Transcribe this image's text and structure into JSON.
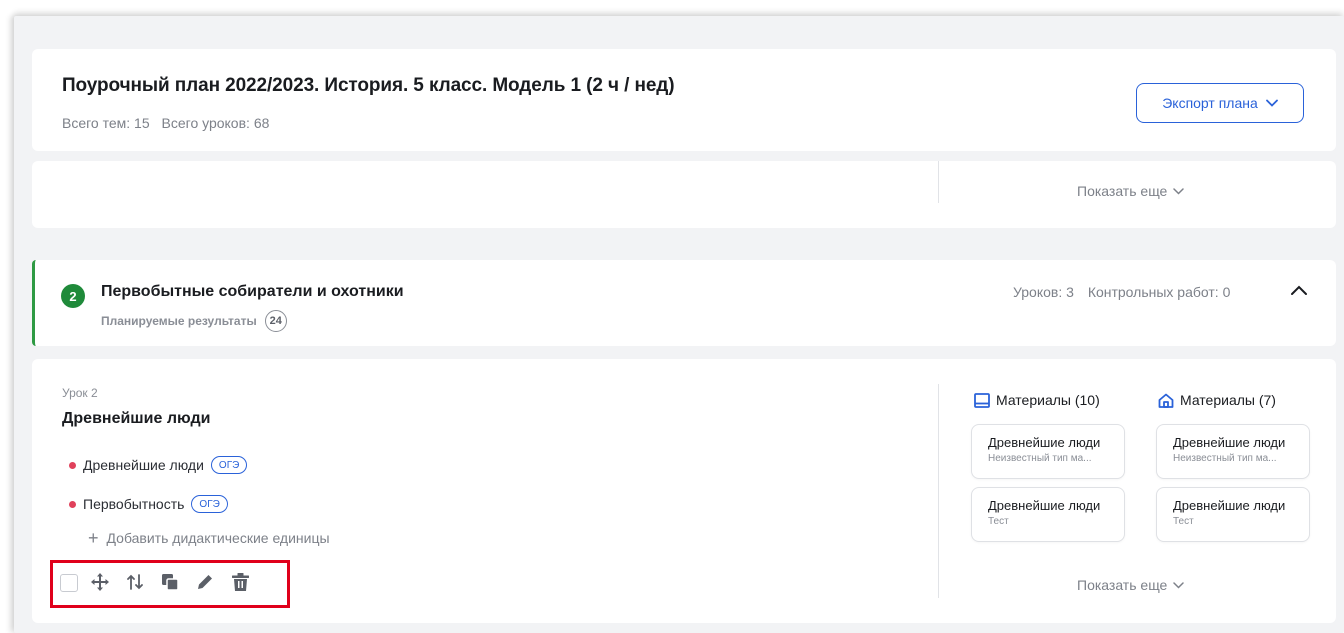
{
  "header": {
    "title": "Поурочный план 2022/2023. История. 5 класс. Модель 1 (2 ч / нед)",
    "total_topics": "Всего тем: 15",
    "total_lessons": "Всего уроков: 68",
    "export_button": "Экспорт плана"
  },
  "show_more_label": "Показать еще",
  "topic": {
    "number": "2",
    "title": "Первобытные собиратели и охотники",
    "planned_results_label": "Планируемые результаты",
    "planned_results_count": "24",
    "lessons_count": "Уроков: 3",
    "tests_count": "Контрольных работ: 0"
  },
  "lesson": {
    "number_label": "Урок 2",
    "title": "Древнейшие люди",
    "didactic_units": [
      {
        "label": "Древнейшие люди",
        "badge": "ОГЭ"
      },
      {
        "label": "Первобытность",
        "badge": "ОГЭ"
      }
    ],
    "add_units_label": "Добавить дидактические единицы",
    "materials_left": {
      "header": "Материалы (10)",
      "items": [
        {
          "title": "Древнейшие люди",
          "subtitle": "Неизвестный тип ма..."
        },
        {
          "title": "Древнейшие люди",
          "subtitle": "Тест"
        }
      ]
    },
    "materials_right": {
      "header": "Материалы (7)",
      "items": [
        {
          "title": "Древнейшие люди",
          "subtitle": "Неизвестный тип ма..."
        },
        {
          "title": "Древнейшие люди",
          "subtitle": "Тест"
        }
      ]
    }
  },
  "icons": {
    "toolbar": [
      "checkbox",
      "move-icon",
      "reorder-icon",
      "copy-icon",
      "edit-icon",
      "delete-icon"
    ]
  },
  "colors": {
    "accent": "#2a62d9",
    "topic_green": "#1f8a3a",
    "dot_red": "#e0415b",
    "highlight_red": "#e0001b"
  }
}
